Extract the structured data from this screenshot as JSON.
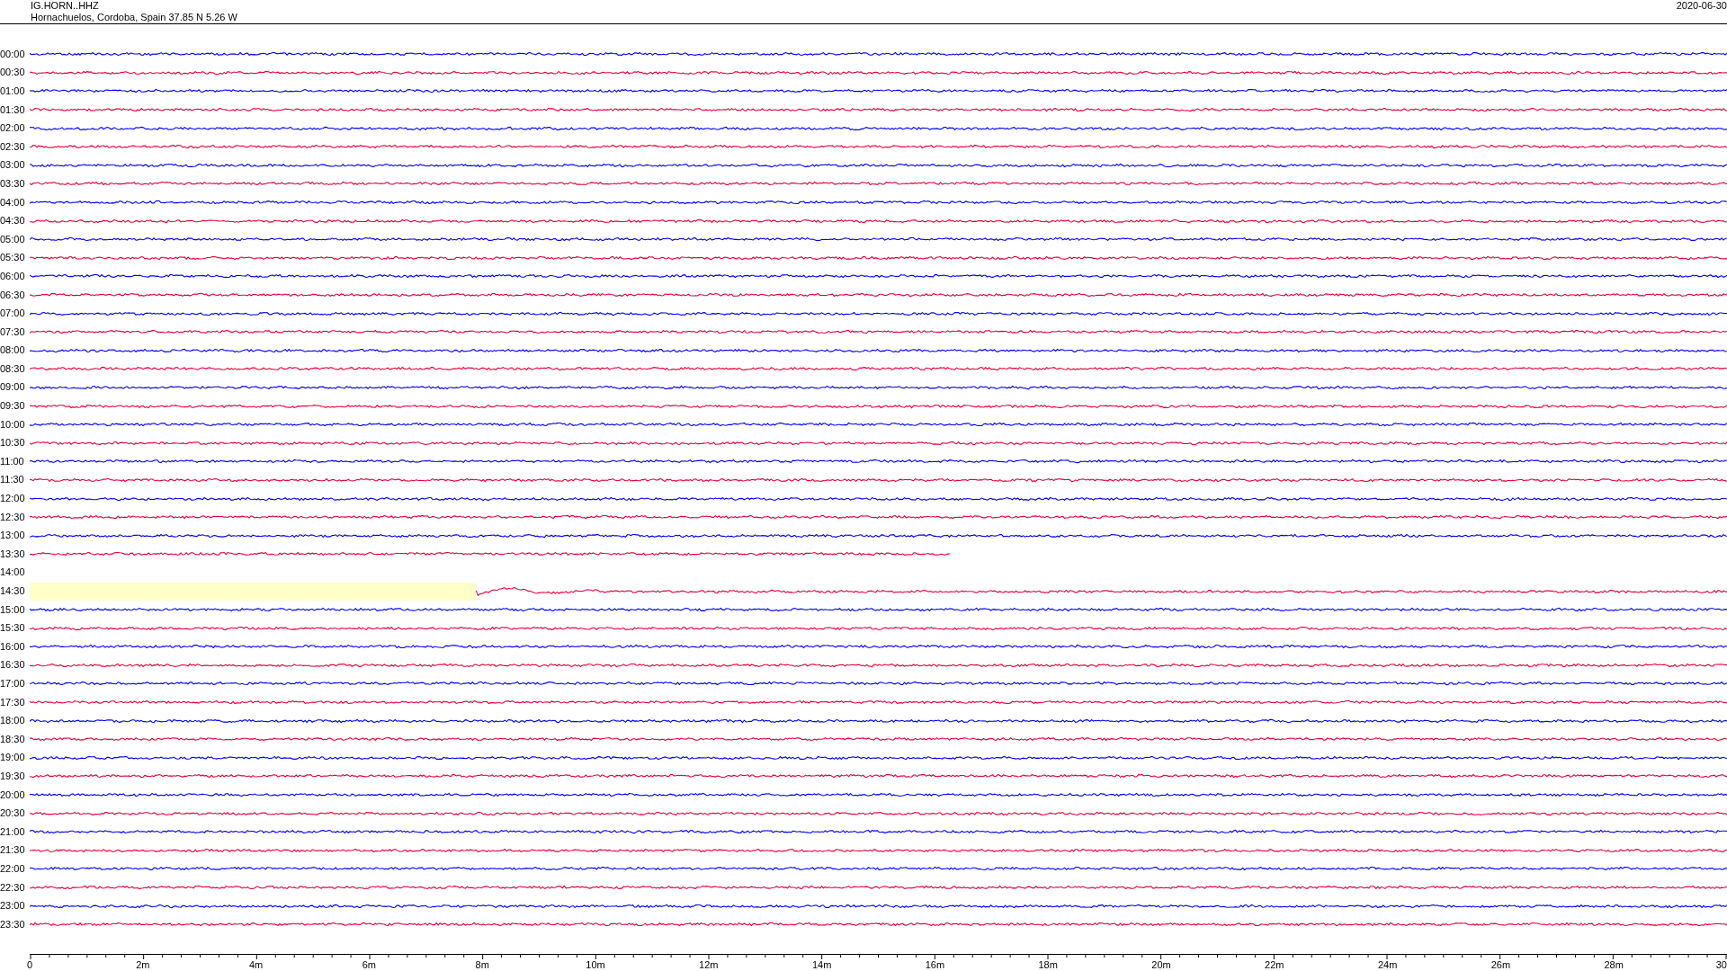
{
  "header": {
    "station": "IG.HORN..HHZ",
    "location": "Hornachuelos, Cordoba, Spain  37.85 N 5.26 W",
    "date": "2020-06-30"
  },
  "rows": [
    {
      "time": "00:00",
      "color": "#0000ff",
      "kind": "trace"
    },
    {
      "time": "00:30",
      "color": "#e6003a",
      "kind": "trace"
    },
    {
      "time": "01:00",
      "color": "#0000ff",
      "kind": "trace"
    },
    {
      "time": "01:30",
      "color": "#e6003a",
      "kind": "trace"
    },
    {
      "time": "02:00",
      "color": "#0000ff",
      "kind": "trace"
    },
    {
      "time": "02:30",
      "color": "#e6003a",
      "kind": "trace"
    },
    {
      "time": "03:00",
      "color": "#0000ff",
      "kind": "trace"
    },
    {
      "time": "03:30",
      "color": "#e6003a",
      "kind": "trace"
    },
    {
      "time": "04:00",
      "color": "#0000ff",
      "kind": "trace"
    },
    {
      "time": "04:30",
      "color": "#e6003a",
      "kind": "trace"
    },
    {
      "time": "05:00",
      "color": "#0000ff",
      "kind": "trace"
    },
    {
      "time": "05:30",
      "color": "#e6003a",
      "kind": "trace"
    },
    {
      "time": "06:00",
      "color": "#0000ff",
      "kind": "trace"
    },
    {
      "time": "06:30",
      "color": "#e6003a",
      "kind": "trace"
    },
    {
      "time": "07:00",
      "color": "#0000ff",
      "kind": "trace"
    },
    {
      "time": "07:30",
      "color": "#e6003a",
      "kind": "trace"
    },
    {
      "time": "08:00",
      "color": "#0000ff",
      "kind": "trace"
    },
    {
      "time": "08:30",
      "color": "#e6003a",
      "kind": "trace"
    },
    {
      "time": "09:00",
      "color": "#0000ff",
      "kind": "trace"
    },
    {
      "time": "09:30",
      "color": "#e6003a",
      "kind": "trace"
    },
    {
      "time": "10:00",
      "color": "#0000ff",
      "kind": "trace"
    },
    {
      "time": "10:30",
      "color": "#e6003a",
      "kind": "trace"
    },
    {
      "time": "11:00",
      "color": "#0000ff",
      "kind": "trace"
    },
    {
      "time": "11:30",
      "color": "#e6003a",
      "kind": "trace"
    },
    {
      "time": "12:00",
      "color": "#0000ff",
      "kind": "trace"
    },
    {
      "time": "12:30",
      "color": "#e6003a",
      "kind": "trace"
    },
    {
      "time": "13:00",
      "color": "#0000ff",
      "kind": "trace"
    },
    {
      "time": "13:30",
      "color": "#e6003a",
      "kind": "trace-ending"
    },
    {
      "time": "14:00",
      "kind": "no-data"
    },
    {
      "time": "14:30",
      "color": "#e6003a",
      "kind": "trace-after-gap"
    },
    {
      "time": "15:00",
      "color": "#0000ff",
      "kind": "trace"
    },
    {
      "time": "15:30",
      "color": "#e6003a",
      "kind": "trace"
    },
    {
      "time": "16:00",
      "color": "#0000ff",
      "kind": "trace"
    },
    {
      "time": "16:30",
      "color": "#e6003a",
      "kind": "trace"
    },
    {
      "time": "17:00",
      "color": "#0000ff",
      "kind": "trace"
    },
    {
      "time": "17:30",
      "color": "#e6003a",
      "kind": "trace"
    },
    {
      "time": "18:00",
      "color": "#0000ff",
      "kind": "trace"
    },
    {
      "time": "18:30",
      "color": "#e6003a",
      "kind": "trace"
    },
    {
      "time": "19:00",
      "color": "#0000ff",
      "kind": "trace"
    },
    {
      "time": "19:30",
      "color": "#e6003a",
      "kind": "trace"
    },
    {
      "time": "20:00",
      "color": "#0000ff",
      "kind": "trace"
    },
    {
      "time": "20:30",
      "color": "#e6003a",
      "kind": "trace"
    },
    {
      "time": "21:00",
      "color": "#0000ff",
      "kind": "trace"
    },
    {
      "time": "21:30",
      "color": "#e6003a",
      "kind": "trace"
    },
    {
      "time": "22:00",
      "color": "#0000ff",
      "kind": "trace"
    },
    {
      "time": "22:30",
      "color": "#e6003a",
      "kind": "trace"
    },
    {
      "time": "23:00",
      "color": "#0000ff",
      "kind": "trace"
    },
    {
      "time": "23:30",
      "color": "#e6003a",
      "kind": "trace"
    }
  ],
  "axis": {
    "ticks": [
      "0",
      "2m",
      "4m",
      "6m",
      "8m",
      "10m",
      "12m",
      "14m",
      "16m",
      "18m",
      "20m",
      "22m",
      "24m",
      "26m",
      "28m",
      "30"
    ]
  }
}
